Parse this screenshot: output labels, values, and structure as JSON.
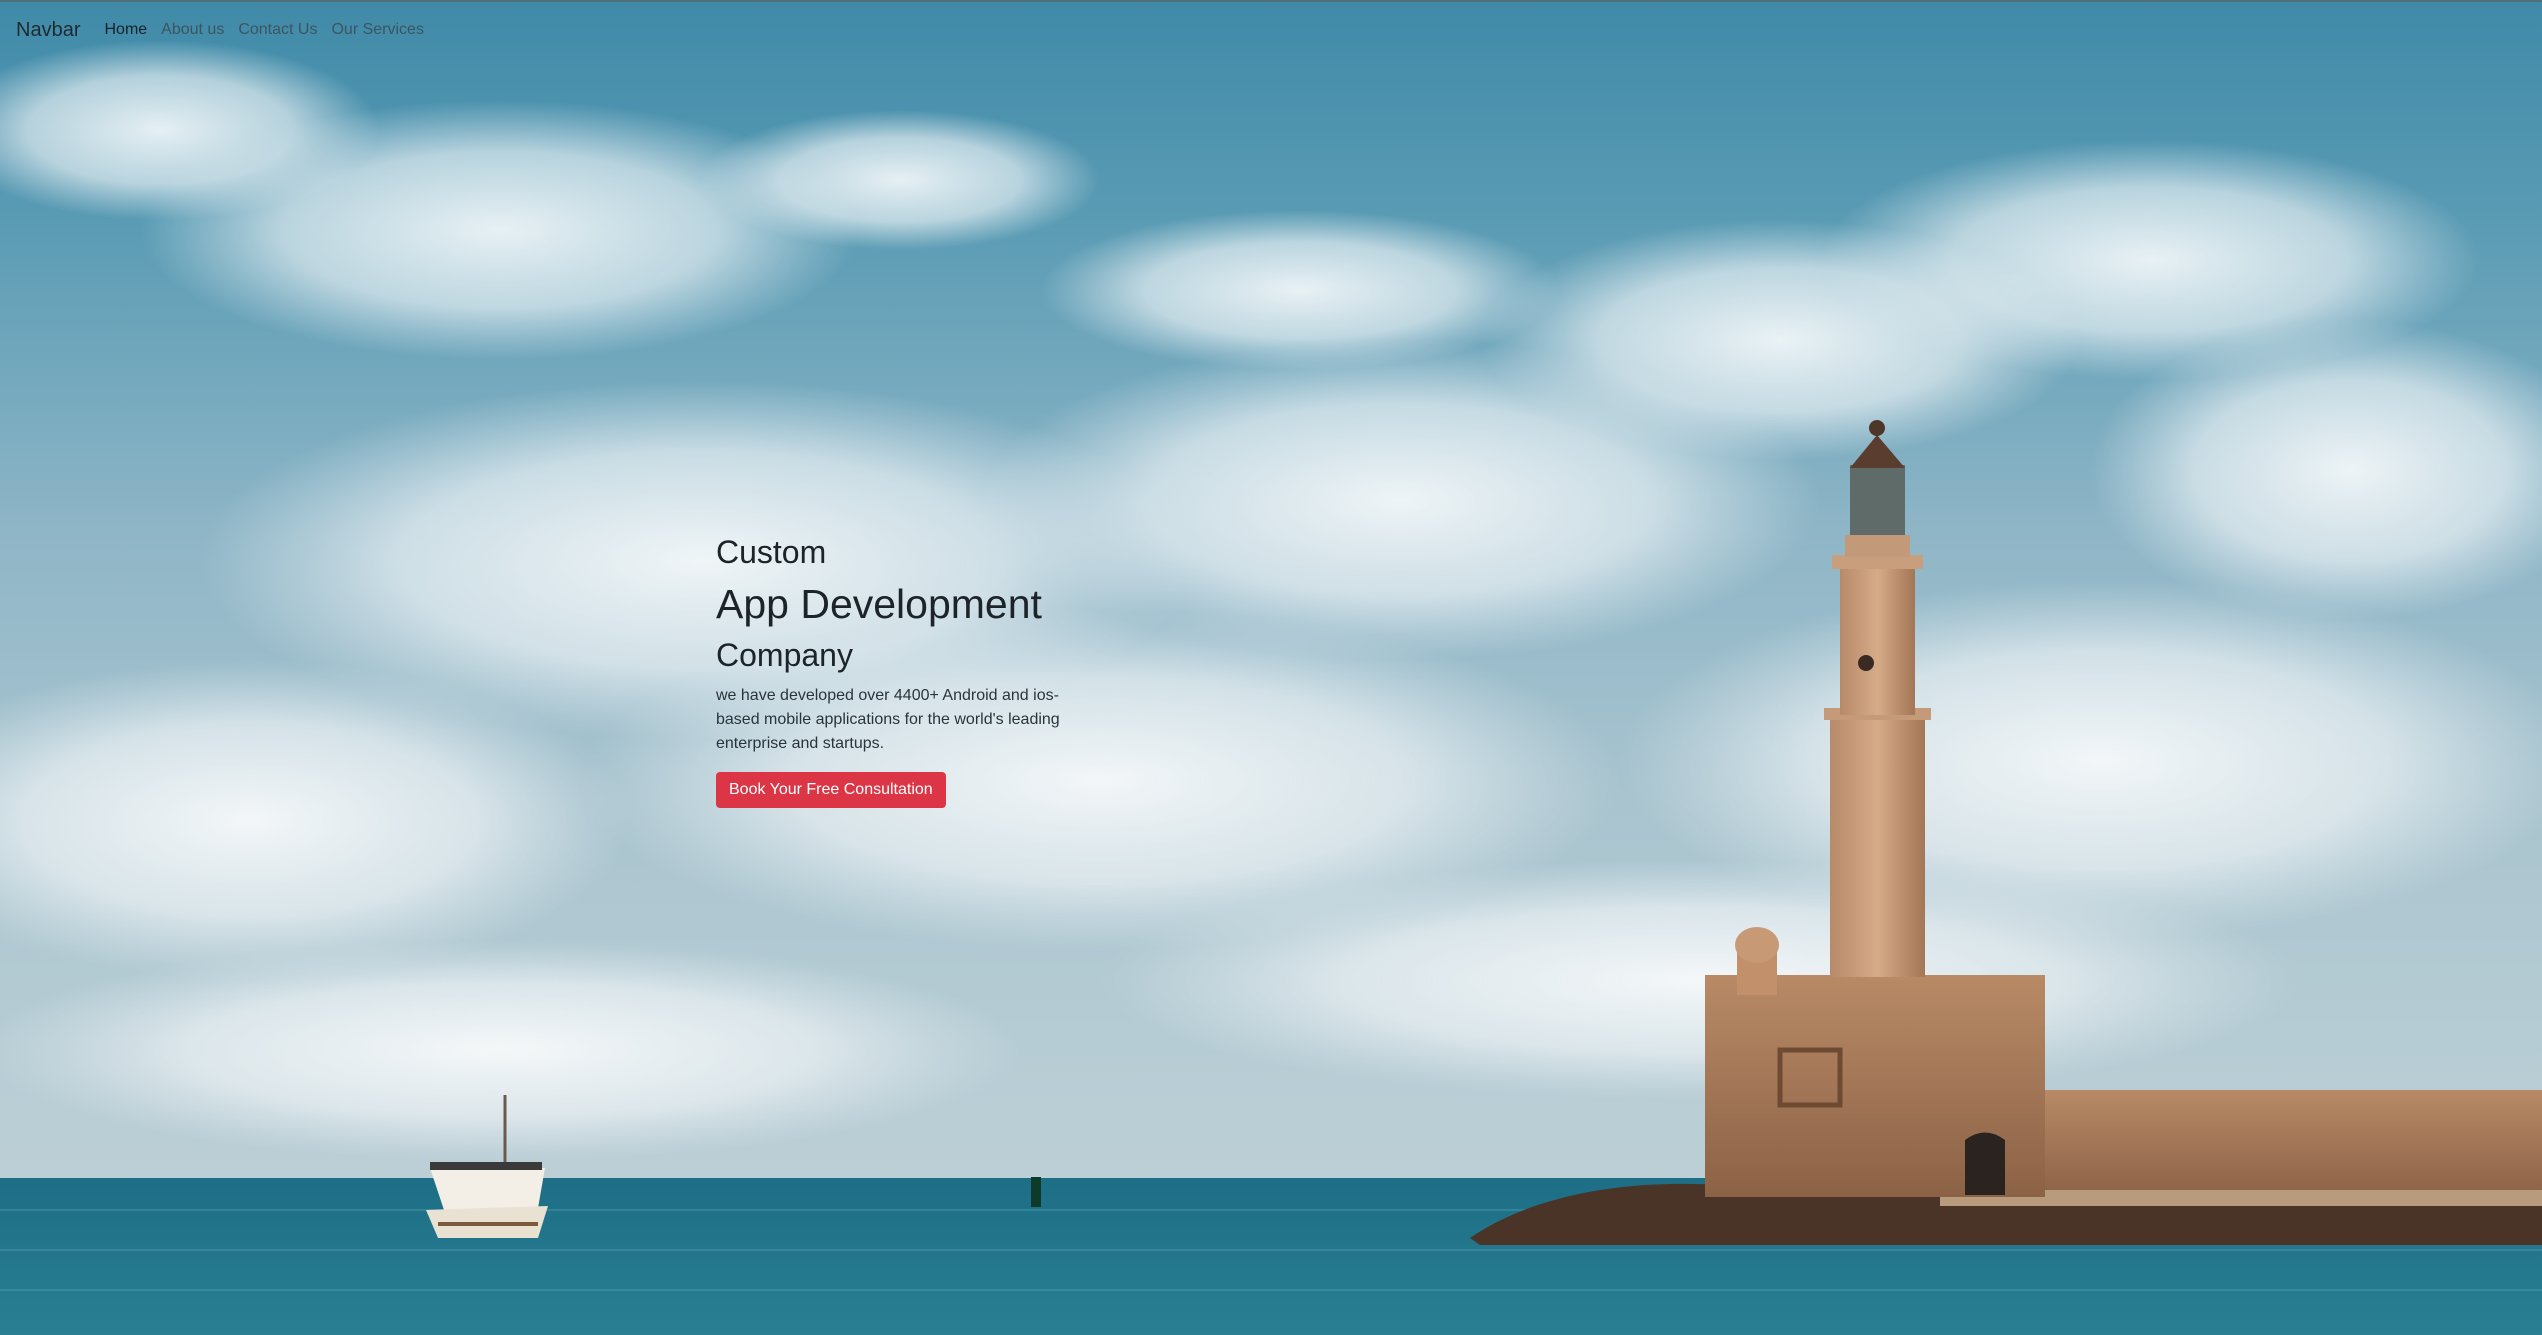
{
  "navbar": {
    "brand": "Navbar",
    "links": [
      {
        "label": "Home",
        "active": true
      },
      {
        "label": "About us",
        "active": false
      },
      {
        "label": "Contact Us",
        "active": false
      },
      {
        "label": "Our Services",
        "active": false
      }
    ]
  },
  "hero": {
    "line1": "Custom",
    "line2": "App Development",
    "line3": "Company",
    "description": "we have developed over 4400+ Android and ios-based mobile applications for the world's leading enterprise and startups.",
    "cta_label": "Book Your Free Consultation"
  },
  "colors": {
    "accent": "#dc3545",
    "sky_top": "#3f8aa8",
    "sea": "#1f6f84"
  }
}
